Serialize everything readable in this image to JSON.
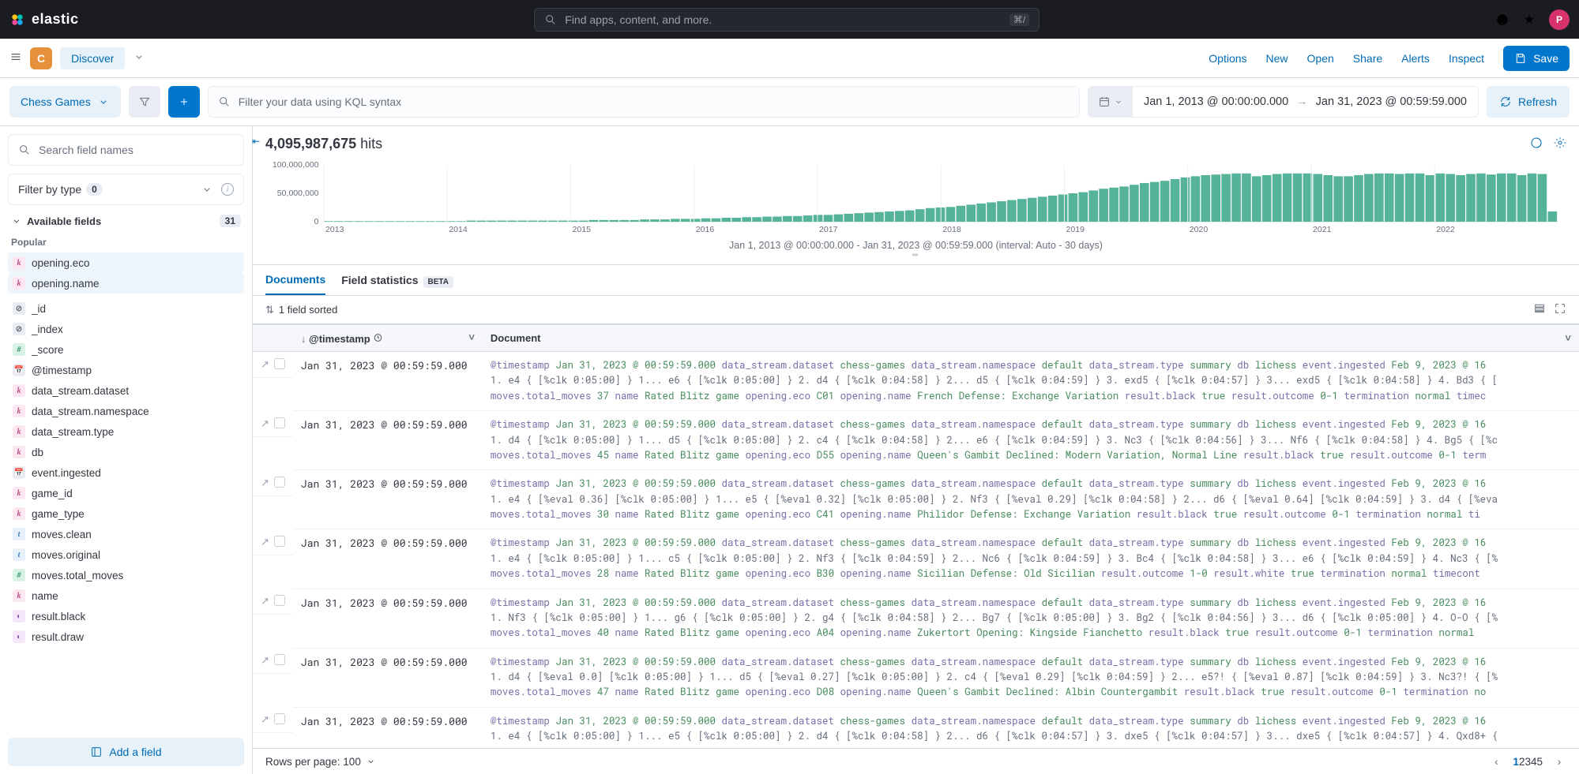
{
  "global": {
    "brand": "elastic",
    "search_placeholder": "Find apps, content, and more.",
    "search_shortcut": "⌘/",
    "avatar_initial": "P"
  },
  "app": {
    "space_initial": "C",
    "app_name": "Discover",
    "links": [
      "Options",
      "New",
      "Open",
      "Share",
      "Alerts",
      "Inspect"
    ],
    "save_label": "Save"
  },
  "query": {
    "data_view": "Chess Games",
    "kql_placeholder": "Filter your data using KQL syntax",
    "date_from": "Jan 1, 2013 @ 00:00:00.000",
    "date_to": "Jan 31, 2023 @ 00:59:59.000",
    "refresh_label": "Refresh"
  },
  "sidebar": {
    "search_placeholder": "Search field names",
    "filter_type_label": "Filter by type",
    "filter_type_count": "0",
    "available_label": "Available fields",
    "available_count": "31",
    "popular_label": "Popular",
    "popular": [
      {
        "type": "k",
        "name": "opening.eco"
      },
      {
        "type": "k",
        "name": "opening.name"
      }
    ],
    "fields": [
      {
        "type": "id",
        "name": "_id"
      },
      {
        "type": "id",
        "name": "_index"
      },
      {
        "type": "h",
        "name": "_score"
      },
      {
        "type": "cal",
        "name": "@timestamp"
      },
      {
        "type": "k",
        "name": "data_stream.dataset"
      },
      {
        "type": "k",
        "name": "data_stream.namespace"
      },
      {
        "type": "k",
        "name": "data_stream.type"
      },
      {
        "type": "k",
        "name": "db"
      },
      {
        "type": "cal",
        "name": "event.ingested"
      },
      {
        "type": "k",
        "name": "game_id"
      },
      {
        "type": "k",
        "name": "game_type"
      },
      {
        "type": "t",
        "name": "moves.clean"
      },
      {
        "type": "t",
        "name": "moves.original"
      },
      {
        "type": "h",
        "name": "moves.total_moves"
      },
      {
        "type": "k",
        "name": "name"
      },
      {
        "type": "bool",
        "name": "result.black"
      },
      {
        "type": "bool",
        "name": "result.draw"
      }
    ],
    "add_field_label": "Add a field"
  },
  "hits": {
    "count": "4,095,987,675",
    "label": "hits"
  },
  "chart_data": {
    "type": "bar",
    "xlabel_years": [
      "2013",
      "2014",
      "2015",
      "2016",
      "2017",
      "2018",
      "2019",
      "2020",
      "2021",
      "2022"
    ],
    "y_ticks": [
      "0",
      "50,000,000",
      "100,000,000"
    ],
    "ylim": [
      0,
      100000000
    ],
    "caption": "Jan 1, 2013 @ 00:00:00.000 - Jan 31, 2023 @ 00:59:59.000 (interval: Auto - 30 days)",
    "values": [
      1,
      1,
      1,
      1,
      1,
      1,
      1,
      1,
      1,
      1,
      1,
      1,
      1,
      1,
      2,
      2,
      2,
      2,
      2,
      2,
      2,
      2,
      2,
      2,
      2,
      2,
      3,
      3,
      3,
      3,
      3,
      4,
      4,
      4,
      5,
      5,
      5,
      6,
      6,
      7,
      7,
      8,
      8,
      9,
      9,
      10,
      10,
      11,
      12,
      12,
      13,
      14,
      15,
      16,
      17,
      18,
      19,
      20,
      22,
      24,
      25,
      26,
      28,
      30,
      32,
      34,
      36,
      38,
      40,
      42,
      44,
      46,
      48,
      50,
      52,
      55,
      58,
      60,
      62,
      65,
      68,
      70,
      72,
      75,
      78,
      80,
      82,
      83,
      84,
      85,
      85,
      80,
      82,
      84,
      85,
      85,
      85,
      84,
      82,
      80,
      80,
      82,
      84,
      85,
      85,
      84,
      85,
      85,
      82,
      85,
      84,
      82,
      84,
      85,
      83,
      85,
      85,
      82,
      85,
      84,
      18
    ],
    "color": "#54b399"
  },
  "tabs": {
    "items": [
      "Documents",
      "Field statistics"
    ],
    "active": 0,
    "beta_label": "BETA"
  },
  "sort": {
    "label": "1 field sorted"
  },
  "table": {
    "headers": {
      "timestamp": "@timestamp",
      "document": "Document"
    },
    "rows": [
      {
        "ts": "Jan 31, 2023 @ 00:59:59.000",
        "segments": [
          [
            "@timestamp",
            "Jan 31, 2023 @ 00:59:59.000"
          ],
          [
            "data_stream.dataset",
            "chess-games"
          ],
          [
            "data_stream.namespace",
            "default"
          ],
          [
            "data_stream.type",
            "summary"
          ],
          [
            "db",
            "lichess"
          ],
          [
            "event.ingested",
            "Feb 9, 2023 @ 16"
          ]
        ],
        "line2": "1. e4 { [%clk 0:05:00] } 1... e6 { [%clk 0:05:00] } 2. d4 { [%clk 0:04:58] } 2... d5 { [%clk 0:04:59] } 3. exd5 { [%clk 0:04:57] } 3... exd5 { [%clk 0:04:58] } 4. Bd3 { [",
        "segments3": [
          [
            "moves.total_moves",
            "37"
          ],
          [
            "name",
            "Rated Blitz game"
          ],
          [
            "opening.eco",
            "C01"
          ],
          [
            "opening.name",
            "French Defense: Exchange Variation"
          ],
          [
            "result.black",
            "true"
          ],
          [
            "result.outcome",
            "0-1"
          ],
          [
            "termination",
            "normal"
          ],
          [
            "timec",
            ""
          ]
        ]
      },
      {
        "ts": "Jan 31, 2023 @ 00:59:59.000",
        "segments": [
          [
            "@timestamp",
            "Jan 31, 2023 @ 00:59:59.000"
          ],
          [
            "data_stream.dataset",
            "chess-games"
          ],
          [
            "data_stream.namespace",
            "default"
          ],
          [
            "data_stream.type",
            "summary"
          ],
          [
            "db",
            "lichess"
          ],
          [
            "event.ingested",
            "Feb 9, 2023 @ 16"
          ]
        ],
        "line2": "1. d4 { [%clk 0:05:00] } 1... d5 { [%clk 0:05:00] } 2. c4 { [%clk 0:04:58] } 2... e6 { [%clk 0:04:59] } 3. Nc3 { [%clk 0:04:56] } 3... Nf6 { [%clk 0:04:58] } 4. Bg5 { [%c",
        "segments3": [
          [
            "moves.total_moves",
            "45"
          ],
          [
            "name",
            "Rated Blitz game"
          ],
          [
            "opening.eco",
            "D55"
          ],
          [
            "opening.name",
            "Queen's Gambit Declined: Modern Variation, Normal Line"
          ],
          [
            "result.black",
            "true"
          ],
          [
            "result.outcome",
            "0-1"
          ],
          [
            "term",
            ""
          ]
        ]
      },
      {
        "ts": "Jan 31, 2023 @ 00:59:59.000",
        "segments": [
          [
            "@timestamp",
            "Jan 31, 2023 @ 00:59:59.000"
          ],
          [
            "data_stream.dataset",
            "chess-games"
          ],
          [
            "data_stream.namespace",
            "default"
          ],
          [
            "data_stream.type",
            "summary"
          ],
          [
            "db",
            "lichess"
          ],
          [
            "event.ingested",
            "Feb 9, 2023 @ 16"
          ]
        ],
        "line2": "1. e4 { [%eval 0.36] [%clk 0:05:00] } 1... e5 { [%eval 0.32] [%clk 0:05:00] } 2. Nf3 { [%eval 0.29] [%clk 0:04:58] } 2... d6 { [%eval 0.64] [%clk 0:04:59] } 3. d4 { [%eva",
        "segments3": [
          [
            "moves.total_moves",
            "30"
          ],
          [
            "name",
            "Rated Blitz game"
          ],
          [
            "opening.eco",
            "C41"
          ],
          [
            "opening.name",
            "Philidor Defense: Exchange Variation"
          ],
          [
            "result.black",
            "true"
          ],
          [
            "result.outcome",
            "0-1"
          ],
          [
            "termination",
            "normal"
          ],
          [
            "ti",
            ""
          ]
        ]
      },
      {
        "ts": "Jan 31, 2023 @ 00:59:59.000",
        "segments": [
          [
            "@timestamp",
            "Jan 31, 2023 @ 00:59:59.000"
          ],
          [
            "data_stream.dataset",
            "chess-games"
          ],
          [
            "data_stream.namespace",
            "default"
          ],
          [
            "data_stream.type",
            "summary"
          ],
          [
            "db",
            "lichess"
          ],
          [
            "event.ingested",
            "Feb 9, 2023 @ 16"
          ]
        ],
        "line2": "1. e4 { [%clk 0:05:00] } 1... c5 { [%clk 0:05:00] } 2. Nf3 { [%clk 0:04:59] } 2... Nc6 { [%clk 0:04:59] } 3. Bc4 { [%clk 0:04:58] } 3... e6 { [%clk 0:04:59] } 4. Nc3 { [%",
        "segments3": [
          [
            "moves.total_moves",
            "28"
          ],
          [
            "name",
            "Rated Blitz game"
          ],
          [
            "opening.eco",
            "B30"
          ],
          [
            "opening.name",
            "Sicilian Defense: Old Sicilian"
          ],
          [
            "result.outcome",
            "1-0"
          ],
          [
            "result.white",
            "true"
          ],
          [
            "termination",
            "normal"
          ],
          [
            "timecont",
            ""
          ]
        ]
      },
      {
        "ts": "Jan 31, 2023 @ 00:59:59.000",
        "segments": [
          [
            "@timestamp",
            "Jan 31, 2023 @ 00:59:59.000"
          ],
          [
            "data_stream.dataset",
            "chess-games"
          ],
          [
            "data_stream.namespace",
            "default"
          ],
          [
            "data_stream.type",
            "summary"
          ],
          [
            "db",
            "lichess"
          ],
          [
            "event.ingested",
            "Feb 9, 2023 @ 16"
          ]
        ],
        "line2": "1. Nf3 { [%clk 0:05:00] } 1... g6 { [%clk 0:05:00] } 2. g4 { [%clk 0:04:58] } 2... Bg7 { [%clk 0:05:00] } 3. Bg2 { [%clk 0:04:56] } 3... d6 { [%clk 0:05:00] } 4. O-O { [%",
        "segments3": [
          [
            "moves.total_moves",
            "40"
          ],
          [
            "name",
            "Rated Blitz game"
          ],
          [
            "opening.eco",
            "A04"
          ],
          [
            "opening.name",
            "Zukertort Opening: Kingside Fianchetto"
          ],
          [
            "result.black",
            "true"
          ],
          [
            "result.outcome",
            "0-1"
          ],
          [
            "termination",
            "normal"
          ],
          [
            "",
            ""
          ]
        ]
      },
      {
        "ts": "Jan 31, 2023 @ 00:59:59.000",
        "segments": [
          [
            "@timestamp",
            "Jan 31, 2023 @ 00:59:59.000"
          ],
          [
            "data_stream.dataset",
            "chess-games"
          ],
          [
            "data_stream.namespace",
            "default"
          ],
          [
            "data_stream.type",
            "summary"
          ],
          [
            "db",
            "lichess"
          ],
          [
            "event.ingested",
            "Feb 9, 2023 @ 16"
          ]
        ],
        "line2": "1. d4 { [%eval 0.0] [%clk 0:05:00] } 1... d5 { [%eval 0.27] [%clk 0:05:00] } 2. c4 { [%eval 0.29] [%clk 0:04:59] } 2... e5?! { [%eval 0.87] [%clk 0:04:59] } 3. Nc3?! { [%",
        "segments3": [
          [
            "moves.total_moves",
            "47"
          ],
          [
            "name",
            "Rated Blitz game"
          ],
          [
            "opening.eco",
            "D08"
          ],
          [
            "opening.name",
            "Queen's Gambit Declined: Albin Countergambit"
          ],
          [
            "result.black",
            "true"
          ],
          [
            "result.outcome",
            "0-1"
          ],
          [
            "termination",
            "no",
            ""
          ]
        ]
      },
      {
        "ts": "Jan 31, 2023 @ 00:59:59.000",
        "segments": [
          [
            "@timestamp",
            "Jan 31, 2023 @ 00:59:59.000"
          ],
          [
            "data_stream.dataset",
            "chess-games"
          ],
          [
            "data_stream.namespace",
            "default"
          ],
          [
            "data_stream.type",
            "summary"
          ],
          [
            "db",
            "lichess"
          ],
          [
            "event.ingested",
            "Feb 9, 2023 @ 16"
          ]
        ],
        "line2": "1. e4 { [%clk 0:05:00] } 1... e5 { [%clk 0:05:00] } 2. d4 { [%clk 0:04:58] } 2... d6 { [%clk 0:04:57] } 3. dxe5 { [%clk 0:04:57] } 3... dxe5 { [%clk 0:04:57] } 4. Qxd8+ {",
        "segments3": []
      }
    ]
  },
  "footer": {
    "rows_label": "Rows per page: 100",
    "pages": [
      "1",
      "2",
      "3",
      "4",
      "5"
    ],
    "active_page": 0
  }
}
